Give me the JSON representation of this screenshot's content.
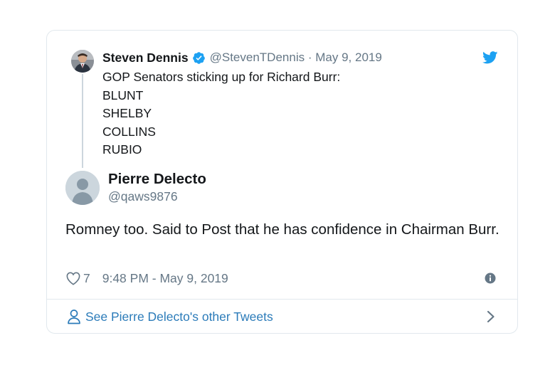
{
  "parent_tweet": {
    "author_name": "Steven Dennis",
    "author_handle": "@StevenTDennis",
    "separator": "·",
    "date": "May 9, 2019",
    "lines": [
      "GOP Senators sticking up for Richard Burr:",
      "BLUNT",
      "SHELBY",
      "COLLINS",
      "RUBIO"
    ],
    "icons": {
      "verified": "verified-badge-icon",
      "brand": "twitter-bird-icon"
    }
  },
  "tweet": {
    "author_name": "Pierre Delecto",
    "author_handle": "@qaws9876",
    "text": "Romney too. Said to Post that he has confidence in Chairman Burr.",
    "like_count": "7",
    "timestamp": "9:48 PM - May 9, 2019",
    "icons": {
      "like": "heart-icon",
      "info": "info-icon",
      "avatar": "default-avatar-icon"
    }
  },
  "footer": {
    "cta_label": "See Pierre Delecto's other Tweets",
    "icons": {
      "person": "person-icon",
      "chevron": "chevron-right-icon"
    }
  },
  "colors": {
    "text": "#14171a",
    "secondary_text": "#657786",
    "link": "#2b7bb9",
    "twitter_blue": "#1da1f2",
    "border": "#e1e8ed"
  }
}
